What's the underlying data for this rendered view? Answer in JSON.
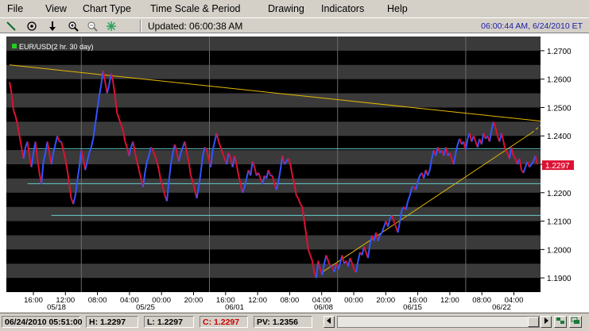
{
  "menu": [
    "File",
    "View",
    "Chart Type",
    "Time Scale & Period",
    "Drawing",
    "Indicators",
    "Help"
  ],
  "toolbar": {
    "updated": "Updated: 06:00:38 AM",
    "clock": "06:00:44 AM, 6/24/2010 ET",
    "icons": [
      "line-draw-icon",
      "crosshair-icon",
      "down-arrow-icon",
      "zoom-in-icon",
      "zoom-out-icon",
      "snowflake-icon"
    ]
  },
  "chart_data": {
    "type": "line",
    "legend": "EUR/USD(2 hr. 30 day)",
    "current_price": "1.2297",
    "y_ticks": [
      "1.2700",
      "1.2600",
      "1.2500",
      "1.2400",
      "1.2300",
      "1.2200",
      "1.2100",
      "1.2000",
      "1.1900"
    ],
    "x_ticks": [
      "16:00",
      "12:00",
      "08:00",
      "04:00",
      "00:00",
      "20:00",
      "16:00",
      "12:00",
      "08:00",
      "04:00",
      "00:00",
      "20:00",
      "16:00",
      "12:00",
      "08:00",
      "04:00"
    ],
    "date_labels": [
      "05/18",
      "05/25",
      "06/01",
      "06/08",
      "06/15",
      "06/22"
    ],
    "ylim": [
      1.185,
      1.275
    ],
    "series": [
      {
        "values": [
          1.259,
          1.255,
          1.249,
          1.247,
          1.244,
          1.24,
          1.236,
          1.232,
          1.236,
          1.238,
          1.233,
          1.229,
          1.234,
          1.238,
          1.232,
          1.227,
          1.223,
          1.231,
          1.234,
          1.238,
          1.234,
          1.23,
          1.234,
          1.237,
          1.24,
          1.238,
          1.238,
          1.235,
          1.232,
          1.228,
          1.223,
          1.218,
          1.216,
          1.219,
          1.224,
          1.229,
          1.235,
          1.232,
          1.228,
          1.231,
          1.234,
          1.236,
          1.239,
          1.244,
          1.249,
          1.254,
          1.258,
          1.263,
          1.259,
          1.255,
          1.258,
          1.262,
          1.259,
          1.254,
          1.248,
          1.246,
          1.244,
          1.242,
          1.238,
          1.236,
          1.233,
          1.236,
          1.238,
          1.234,
          1.231,
          1.228,
          1.225,
          1.222,
          1.227,
          1.231,
          1.233,
          1.236,
          1.235,
          1.233,
          1.231,
          1.228,
          1.224,
          1.222,
          1.219,
          1.217,
          1.224,
          1.23,
          1.234,
          1.237,
          1.234,
          1.231,
          1.234,
          1.236,
          1.238,
          1.234,
          1.231,
          1.226,
          1.224,
          1.221,
          1.218,
          1.222,
          1.227,
          1.233,
          1.236,
          1.235,
          1.232,
          1.229,
          1.235,
          1.238,
          1.241,
          1.238,
          1.236,
          1.234,
          1.232,
          1.23,
          1.234,
          1.232,
          1.229,
          1.233,
          1.23,
          1.226,
          1.223,
          1.22,
          1.222,
          1.225,
          1.228,
          1.226,
          1.231,
          1.229,
          1.226,
          1.227,
          1.225,
          1.223,
          1.226,
          1.225,
          1.228,
          1.226,
          1.226,
          1.223,
          1.221,
          1.224,
          1.228,
          1.233,
          1.23,
          1.231,
          1.232,
          1.23,
          1.226,
          1.223,
          1.219,
          1.218,
          1.216,
          1.215,
          1.21,
          1.205,
          1.2,
          1.198,
          1.196,
          1.192,
          1.19,
          1.196,
          1.193,
          1.191,
          1.195,
          1.198,
          1.196,
          1.194,
          1.194,
          1.192,
          1.195,
          1.193,
          1.195,
          1.198,
          1.195,
          1.196,
          1.194,
          1.197,
          1.195,
          1.193,
          1.192,
          1.196,
          1.199,
          1.198,
          1.201,
          1.199,
          1.197,
          1.202,
          1.205,
          1.203,
          1.206,
          1.203,
          1.205,
          1.206,
          1.208,
          1.21,
          1.208,
          1.211,
          1.212,
          1.21,
          1.208,
          1.206,
          1.21,
          1.214,
          1.215,
          1.214,
          1.217,
          1.219,
          1.222,
          1.222,
          1.221,
          1.224,
          1.226,
          1.227,
          1.225,
          1.228,
          1.226,
          1.228,
          1.232,
          1.235,
          1.233,
          1.236,
          1.234,
          1.235,
          1.233,
          1.236,
          1.233,
          1.234,
          1.232,
          1.23,
          1.234,
          1.237,
          1.239,
          1.237,
          1.238,
          1.235,
          1.239,
          1.241,
          1.238,
          1.24,
          1.238,
          1.236,
          1.239,
          1.237,
          1.241,
          1.239,
          1.24,
          1.238,
          1.242,
          1.245,
          1.243,
          1.24,
          1.238,
          1.241,
          1.238,
          1.235,
          1.234,
          1.232,
          1.236,
          1.233,
          1.232,
          1.23,
          1.232,
          1.228,
          1.227,
          1.229,
          1.231,
          1.229,
          1.23,
          1.231,
          1.233,
          1.23
        ]
      }
    ],
    "trendlines": [
      {
        "color": "#e6b800",
        "points": [
          [
            0,
            1.265
          ],
          [
            283,
            1.244
          ]
        ]
      },
      {
        "color": "#e6b800",
        "points": [
          [
            157,
            1.192
          ],
          [
            262,
            1.241
          ]
        ]
      },
      {
        "color": "#e6b800",
        "points": [
          [
            262,
            1.241
          ],
          [
            283,
            1.253
          ]
        ],
        "dashed": true
      },
      {
        "color": "#66cccc",
        "points": [
          [
            9,
            1.2355
          ],
          [
            283,
            1.2355
          ]
        ]
      },
      {
        "color": "#66cccc",
        "points": [
          [
            9,
            1.2232
          ],
          [
            283,
            1.2232
          ]
        ]
      },
      {
        "color": "#66cccc",
        "points": [
          [
            21,
            1.212
          ],
          [
            283,
            1.212
          ]
        ]
      }
    ]
  },
  "status": {
    "datetime": "06/24/2010 05:51:00",
    "high": "H: 1.2297",
    "low": "L: 1.2297",
    "close": "C: 1.2297",
    "pv": "PV: 1.2356"
  },
  "colors": {
    "down": "#dd1133",
    "up": "#3355ff",
    "band_dark": "#000000",
    "band_light": "#3a3a3a",
    "axis_bg": "#ffffff",
    "close_value": "#cc0000"
  }
}
